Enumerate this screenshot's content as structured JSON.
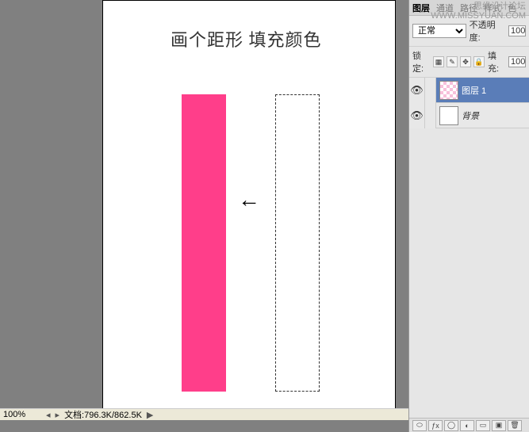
{
  "watermark": {
    "line1": "思缘设计论坛",
    "line2": "WWW.MISSYUAN.COM"
  },
  "canvas": {
    "instruction": "画个距形 填充颜色",
    "arrow": "←",
    "pinkColor": "#ff3e8a"
  },
  "statusbar": {
    "zoom": "100%",
    "nav_left": "◂",
    "nav_right": "▸",
    "docinfo": "文档:796.3K/862.5K",
    "play": "▶"
  },
  "panel": {
    "tabs": {
      "layers": "图层",
      "channels": "通道",
      "paths": "路径",
      "styles": "样式",
      "color": "色"
    },
    "blend": {
      "value": "正常"
    },
    "opacity": {
      "label": "不透明度:",
      "value": "100"
    },
    "lock": {
      "label": "锁定:",
      "fill_label": "填充:",
      "fill_value": "100"
    },
    "lock_icons": {
      "trans": "▦",
      "paint": "✎",
      "move": "✥",
      "all": "🔒"
    },
    "layers": [
      {
        "name": "图层 1",
        "eye": "👁"
      },
      {
        "name": "背景",
        "eye": "👁"
      }
    ],
    "footer": {
      "link": "⬭",
      "fx": "ƒx",
      "mask": "◯",
      "adjust": "◐",
      "group": "▭",
      "new": "▣",
      "trash": "🗑"
    }
  }
}
